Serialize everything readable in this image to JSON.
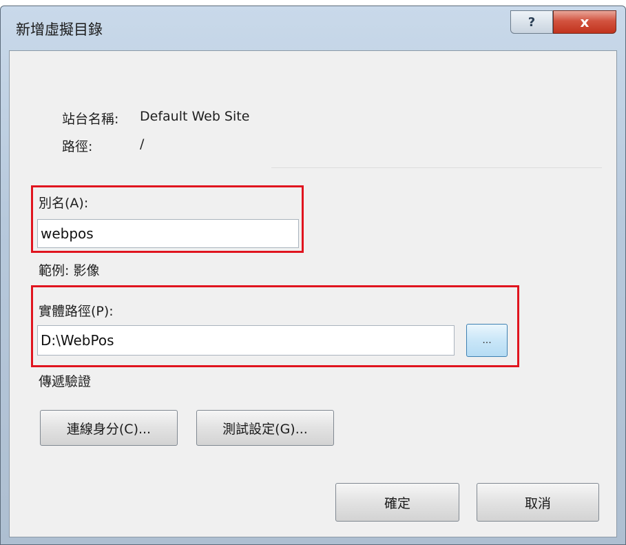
{
  "dialog": {
    "title": "新增虛擬目錄",
    "help_label": "?",
    "close_label": "x"
  },
  "site_info": {
    "site_name_label": "站台名稱:",
    "site_name_value": "Default Web Site",
    "path_label": "路徑:",
    "path_value": "/"
  },
  "alias": {
    "label": "別名(A):",
    "value": "webpos",
    "example": "範例: 影像"
  },
  "physical_path": {
    "label": "實體路徑(P):",
    "value": "D:\\WebPos",
    "browse_label": "..."
  },
  "pass_through": {
    "label": "傳遞驗證"
  },
  "buttons": {
    "connect_as": "連線身分(C)...",
    "test_settings": "測試設定(G)...",
    "ok": "確定",
    "cancel": "取消"
  },
  "colors": {
    "highlight": "#e0141e",
    "close_button": "#c1331d",
    "window_frame": "#b7c9dc"
  }
}
